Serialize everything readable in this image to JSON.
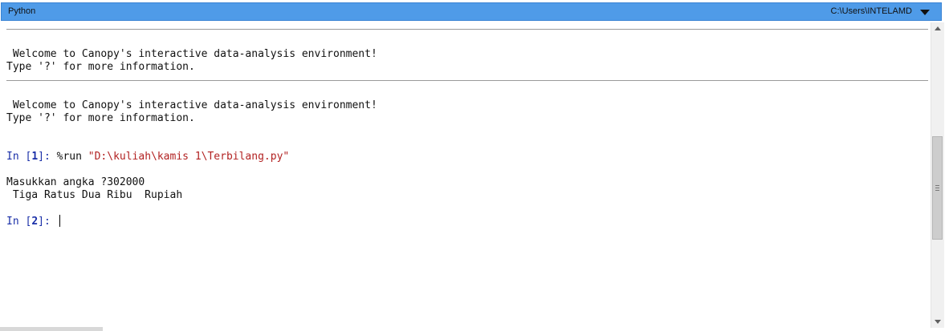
{
  "window": {
    "title": "Python",
    "cwd": "C:\\Users\\INTELAMD"
  },
  "console": {
    "banner1": " Welcome to Canopy's interactive data-analysis environment!",
    "banner1_info": "Type '?' for more information.",
    "banner2": " Welcome to Canopy's interactive data-analysis environment!",
    "banner2_info": "Type '?' for more information.",
    "cell1": {
      "prompt_prefix": "In [",
      "number": "1",
      "prompt_suffix": "]: ",
      "magic": "%run ",
      "argument": "\"D:\\kuliah\\kamis 1\\Terbilang.py\""
    },
    "output_line1": "Masukkan angka ?302000",
    "output_line2": " Tiga Ratus Dua Ribu  Rupiah",
    "cell2": {
      "prompt_prefix": "In [",
      "number": "2",
      "prompt_suffix": "]: ",
      "input_value": ""
    }
  },
  "colors": {
    "titlebar": "#4f9be8",
    "prompt": "#1a2fa8",
    "string": "#b22222"
  },
  "icons": {
    "dropdown": "chevron-down-icon",
    "scroll_up": "scroll-up-icon",
    "scroll_down": "scroll-down-icon"
  }
}
